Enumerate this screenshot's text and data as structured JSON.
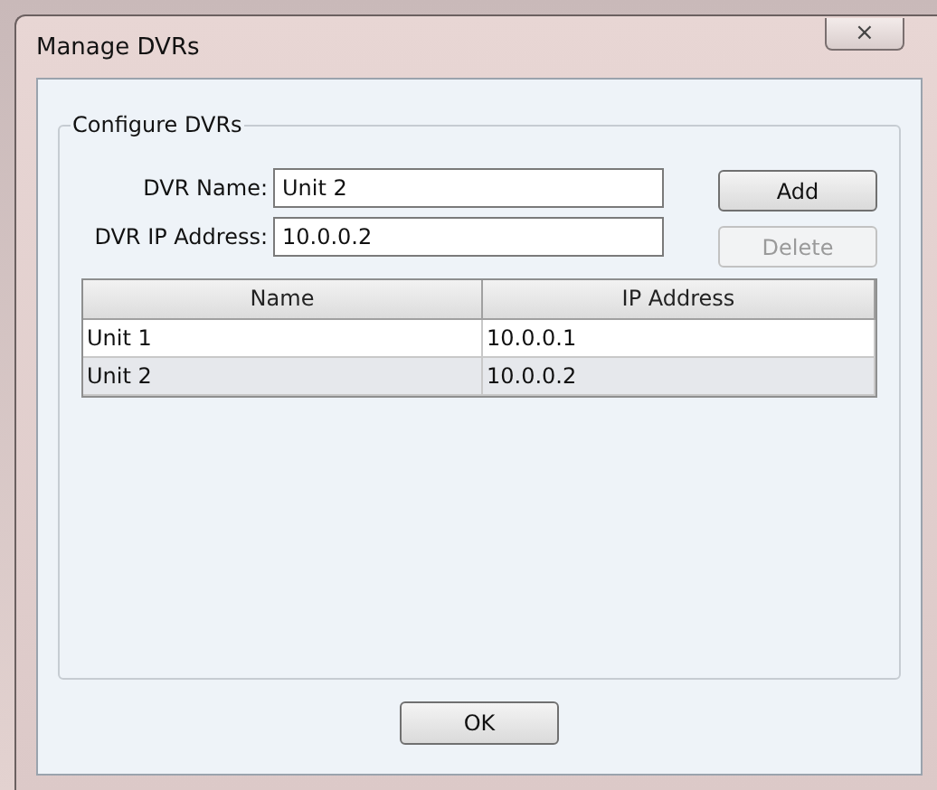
{
  "window": {
    "title": "Manage DVRs",
    "close_label": "⨯"
  },
  "group": {
    "title": "Configure DVRs"
  },
  "fields": [
    {
      "label": "DVR Name:",
      "value": "Unit 2"
    },
    {
      "label": "DVR IP Address:",
      "value": "10.0.0.2"
    }
  ],
  "side_buttons": [
    {
      "label": "Add",
      "disabled": false
    },
    {
      "label": "Delete",
      "disabled": true
    }
  ],
  "table": {
    "columns": [
      "Name",
      "IP Address"
    ],
    "rows": [
      {
        "cells": [
          "Unit 1",
          "10.0.0.1"
        ],
        "selected": false
      },
      {
        "cells": [
          "Unit 2",
          "10.0.0.2"
        ],
        "selected": true
      }
    ]
  },
  "buttons": [
    {
      "label": "OK"
    }
  ]
}
